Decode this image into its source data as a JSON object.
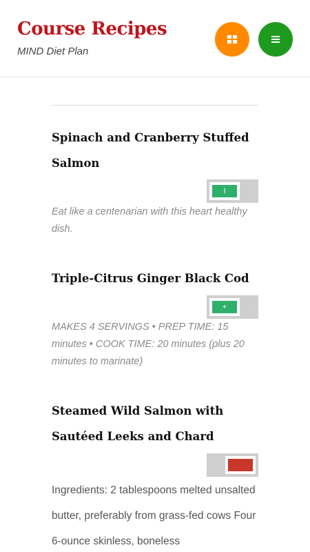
{
  "header": {
    "title": "Course Recipes",
    "subtitle": "MIND Diet Plan",
    "grid_button": {
      "icon": "grid-icon",
      "color": "#ff8a00"
    },
    "menu_button": {
      "icon": "hamburger-menu-icon",
      "color": "#1e9b1e"
    }
  },
  "colors": {
    "title": "#c0151b",
    "toggle_green": "#2fb06a",
    "toggle_red": "#c8382a"
  },
  "recipes": [
    {
      "title": "Spinach and Cranberry Stuffed Salmon",
      "toggle_symbol": "I",
      "toggle_color": "#2fb06a",
      "description": "Eat like a centenarian with this heart healthy dish."
    },
    {
      "title": "Triple-Citrus Ginger Black Cod",
      "toggle_symbol": "+",
      "toggle_color": "#2fb06a",
      "description": "MAKES 4 SERVINGS • PREP TIME: 15 minutes • COOK TIME: 20 minutes (plus 20 minutes to marinate)"
    },
    {
      "title": "Steamed Wild Salmon with Sautéed Leeks and Chard",
      "toggle_symbol": "",
      "toggle_color": "#c8382a",
      "description": "Ingredients: 2 tablespoons melted unsalted butter, preferably from grass-fed cows Four 6-ounce skinless, boneless"
    }
  ]
}
